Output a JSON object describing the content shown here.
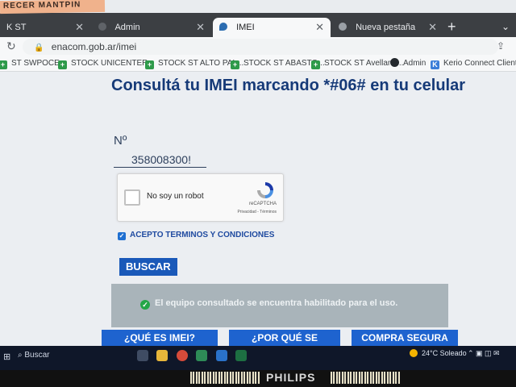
{
  "sticker": {
    "text": "RECER  MANTPIN"
  },
  "tabs": [
    {
      "label": "K ST SWPOCENTRAL -",
      "active": false
    },
    {
      "label": "Admin",
      "active": false
    },
    {
      "label": "IMEI",
      "active": true
    },
    {
      "label": "Nueva pestaña",
      "active": false
    }
  ],
  "address_bar": {
    "url": "enacom.gob.ar/imei"
  },
  "bookmarks": [
    {
      "label": "ST SWPOCE...",
      "icon": "green-sheet-icon"
    },
    {
      "label": "STOCK UNICENTER...",
      "icon": "green-sheet-icon"
    },
    {
      "label": "STOCK ST ALTO PAL...",
      "icon": "green-sheet-icon"
    },
    {
      "label": "STOCK ST ABASTO...",
      "icon": "green-sheet-icon"
    },
    {
      "label": "STOCK ST Avellane...",
      "icon": "green-sheet-icon"
    },
    {
      "label": "Admin",
      "icon": "github-icon"
    },
    {
      "label": "Kerio Connect Client",
      "icon": "kerio-icon"
    }
  ],
  "page": {
    "title": "Consultá tu IMEI marcando *#06# en tu celular",
    "field_label": "Nº",
    "imei_value": "358008300!",
    "captcha": {
      "label": "No soy un robot",
      "brand": "reCAPTCHA",
      "legal": "Privacidad - Términos"
    },
    "terms_label": "ACEPTO TERMINOS Y CONDICIONES",
    "terms_checked": true,
    "search_button": "BUSCAR",
    "result_message": "El equipo consultado se encuentra habilitado para el uso.",
    "bottom_buttons": [
      "¿QUÉ ES IMEI?",
      "¿POR QUÉ SE",
      "COMPRA SEGURA"
    ]
  },
  "taskbar": {
    "search_label": "Buscar",
    "weather": "24°C  Soleado"
  },
  "monitor": {
    "brand": "PHILIPS"
  }
}
